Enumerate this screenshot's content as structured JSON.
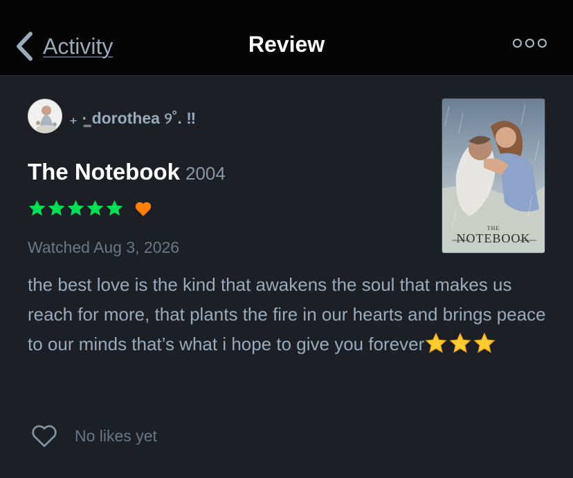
{
  "header": {
    "back_label": "Activity",
    "title": "Review"
  },
  "author": {
    "name": "₊ ·͇ dorothea ୨˚. ‼"
  },
  "film": {
    "title": "The Notebook",
    "year": "2004",
    "poster_small_text": "THE",
    "poster_title": "NOTEBOOK"
  },
  "rating": {
    "stars": 5,
    "max_stars": 5,
    "liked": true,
    "star_color": "#00e054",
    "heart_color": "#ff8000"
  },
  "watched": "Watched Aug 3, 2026",
  "review": {
    "text": "the best love is the kind that awakens the soul that makes us reach for more, that plants the fire in our hearts and brings peace to our minds that’s what i hope to give you forever",
    "trailing_emoji": [
      "star",
      "star",
      "star"
    ]
  },
  "likes": {
    "label": "No likes yet"
  }
}
